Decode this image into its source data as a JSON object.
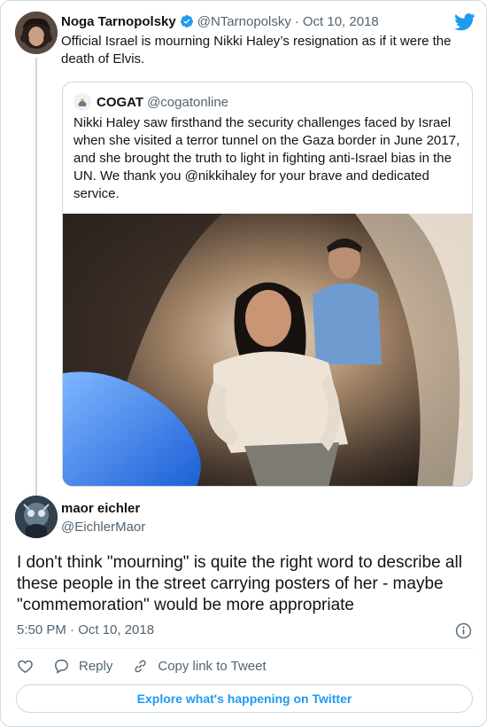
{
  "parent_tweet": {
    "author_name": "Noga Tarnopolsky",
    "handle": "@NTarnopolsky",
    "separator": "·",
    "date": "Oct 10, 2018",
    "text": "Official Israel is mourning Nikki Haley’s resignation as if it were the death of Elvis.",
    "verified_icon": "verified-badge-icon",
    "platform_icon": "twitter-bird-icon"
  },
  "quoted_tweet": {
    "author_name": "COGAT",
    "handle": "@cogatonline",
    "text": "Nikki Haley saw firsthand the security challenges faced by Israel when she visited a terror tunnel on the Gaza border in June 2017, and she brought the truth to light in fighting anti-Israel bias in the UN. We thank you @nikkihaley for your brave and dedicated service."
  },
  "reply_tweet": {
    "author_name": "maor eichler",
    "handle": "@EichlerMaor",
    "text": "I don't think \"mourning\" is quite the right word to describe all these people in the street carrying posters of her - maybe \"commemoration\" would be more appropriate",
    "timestamp": "5:50 PM · Oct 10, 2018"
  },
  "actions": {
    "reply_label": "Reply",
    "copy_link_label": "Copy link to Tweet"
  },
  "explore_label": "Explore what's happening on Twitter",
  "colors": {
    "accent": "#1d9bf0",
    "text": "#0f1419",
    "secondary": "#536471",
    "border": "#cfd9de"
  }
}
